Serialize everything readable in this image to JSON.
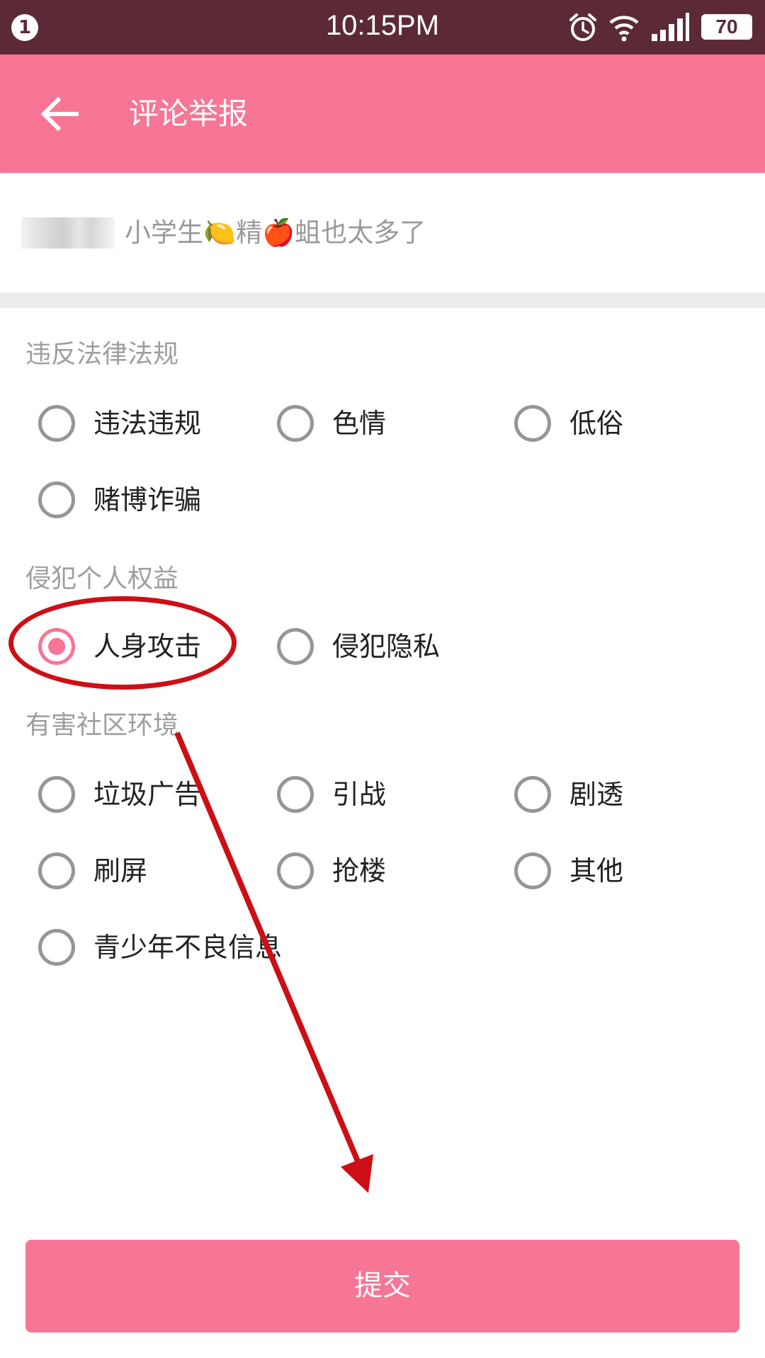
{
  "status_bar": {
    "notification_count": "1",
    "time": "10:15PM",
    "battery": "70",
    "icons": [
      "alarm-icon",
      "wifi-icon",
      "signal-icon",
      "battery-icon"
    ]
  },
  "app_bar": {
    "title": "评论举报",
    "back_icon": "arrow-left-icon",
    "color": "#f77595"
  },
  "comment": {
    "text": "小学生🍋精🍎蛆也太多了"
  },
  "sections": [
    {
      "title": "违反法律法规",
      "options": [
        "违法违规",
        "色情",
        "低俗",
        "赌博诈骗"
      ]
    },
    {
      "title": "侵犯个人权益",
      "options": [
        "人身攻击",
        "侵犯隐私"
      ]
    },
    {
      "title": "有害社区环境",
      "options": [
        "垃圾广告",
        "引战",
        "剧透",
        "刷屏",
        "抢楼",
        "其他",
        "青少年不良信息"
      ]
    }
  ],
  "selected_option": "人身攻击",
  "submit": {
    "label": "提交"
  },
  "colors": {
    "status_bar": "#5c2a36",
    "accent": "#f77595",
    "annotation": "#cc0f16"
  }
}
